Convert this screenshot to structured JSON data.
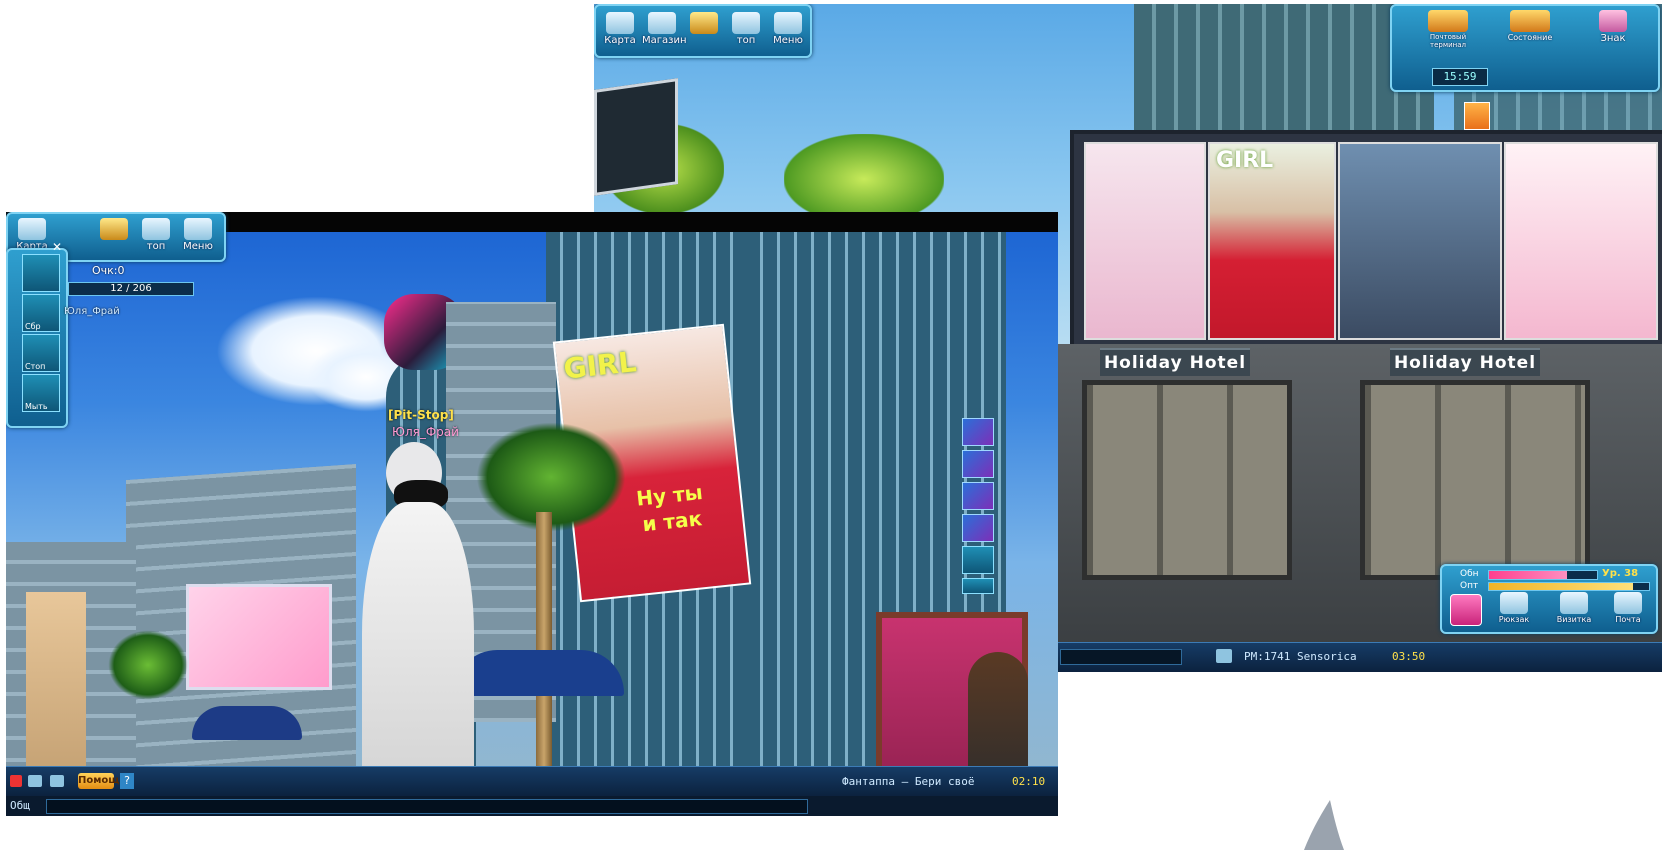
{
  "back_screen": {
    "top_menu": [
      {
        "label": "Карта",
        "icon": "map-icon"
      },
      {
        "label": "Магазин",
        "icon": "shop-cart-icon"
      },
      {
        "label": "",
        "icon": "shop-stall-icon"
      },
      {
        "label": "топ",
        "icon": "trophy-icon"
      },
      {
        "label": "Меню",
        "icon": "menu-icon"
      }
    ],
    "top_right_panel": {
      "buttons": [
        {
          "label": "Почтовый терминал",
          "icon": "mail-terminal-icon"
        },
        {
          "label": "Состояние",
          "icon": "status-wings-icon"
        },
        {
          "label": "Знак",
          "icon": "couple-icon"
        }
      ],
      "clock": "15:59"
    },
    "hotel_signs": [
      "Holiday  Hotel",
      "Holiday  Hotel"
    ],
    "poster_cover_text": "GIRL",
    "status_panel": {
      "hp_label": "Обн",
      "exp_label": "Опт",
      "level_label": "Ур. 38",
      "hp_fraction": 0.72,
      "exp_fraction": 0.9,
      "buttons": [
        "Рюкзак",
        "Визитка",
        "Почта"
      ]
    },
    "chat_line": "PM:1741  Sensorica",
    "chat_time": "03:50"
  },
  "front_screen": {
    "top_menu": [
      {
        "label": "Карта",
        "icon": "map-icon"
      },
      {
        "label": "",
        "icon": "shop-stall-icon"
      },
      {
        "label": "топ",
        "icon": "trophy-icon"
      },
      {
        "label": "Меню",
        "icon": "menu-icon"
      }
    ],
    "side_panel": {
      "score_label": "Очк:0",
      "progress_text": "12 / 206",
      "items": [
        "",
        "Сбр",
        "Стоп",
        "Мыть"
      ],
      "player_name": "Юля_Фрай"
    },
    "character": {
      "guild_tag": "[Pit-Stop]",
      "name": "Юля_Фрай"
    },
    "magazine": {
      "brand": "GIRL",
      "headline": "Ну ты и так"
    },
    "bottom_bar": {
      "channel": "Общ",
      "hint_button": "Помощ",
      "chat_line": "Фантаппа – Бери своё",
      "time": "02:10"
    },
    "right_emote_slots": [
      "1",
      "2",
      "3",
      "4",
      "5",
      "6"
    ]
  },
  "colors": {
    "hud_blue": "#1f7fb0",
    "hud_border": "#7fd3f3",
    "hp_pink": "#ff3f8e",
    "exp_yellow": "#f1b428"
  }
}
